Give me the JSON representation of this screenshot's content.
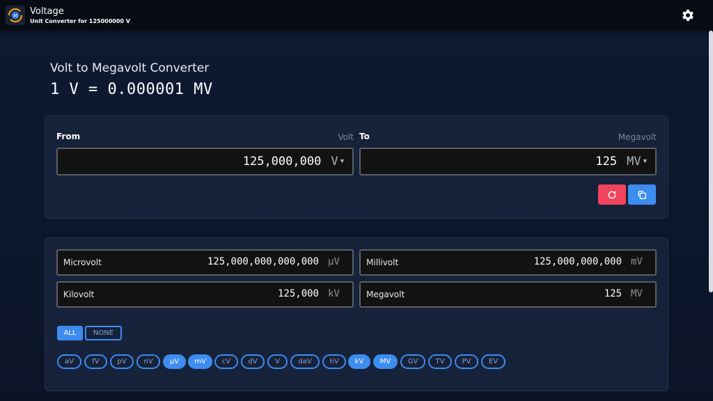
{
  "header": {
    "title": "Voltage",
    "subtitle": "Unit Converter for 125000000 V",
    "app_icon": "converter-icon",
    "settings_icon": "gear-icon"
  },
  "converter": {
    "title": "Volt to Megavolt Converter",
    "formula": "1 V = 0.000001 MV"
  },
  "from": {
    "label": "From",
    "unit_name": "Volt",
    "value": "125,000,000",
    "unit": "V"
  },
  "to": {
    "label": "To",
    "unit_name": "Megavolt",
    "value": "125",
    "unit": "MV"
  },
  "actions": {
    "reset_icon": "refresh-icon",
    "copy_icon": "copy-icon"
  },
  "results": [
    {
      "name": "Microvolt",
      "value": "125,000,000,000,000",
      "unit": "µV"
    },
    {
      "name": "Millivolt",
      "value": "125,000,000,000",
      "unit": "mV"
    },
    {
      "name": "Kilovolt",
      "value": "125,000",
      "unit": "kV"
    },
    {
      "name": "Megavolt",
      "value": "125",
      "unit": "MV"
    }
  ],
  "filters": {
    "all_label": "ALL",
    "none_label": "NONE"
  },
  "chips": [
    {
      "label": "aV",
      "selected": false
    },
    {
      "label": "fV",
      "selected": false
    },
    {
      "label": "pV",
      "selected": false
    },
    {
      "label": "nV",
      "selected": false
    },
    {
      "label": "µV",
      "selected": true
    },
    {
      "label": "mV",
      "selected": true
    },
    {
      "label": "cV",
      "selected": false
    },
    {
      "label": "dV",
      "selected": false
    },
    {
      "label": "V",
      "selected": false
    },
    {
      "label": "daV",
      "selected": false
    },
    {
      "label": "hV",
      "selected": false
    },
    {
      "label": "kV",
      "selected": true
    },
    {
      "label": "MV",
      "selected": true
    },
    {
      "label": "GV",
      "selected": false
    },
    {
      "label": "TV",
      "selected": false
    },
    {
      "label": "PV",
      "selected": false
    },
    {
      "label": "EV",
      "selected": false
    }
  ],
  "colors": {
    "accent": "#3d8cf0",
    "danger": "#f0455c",
    "background": "#0e1a33",
    "panel": "#16223a"
  }
}
